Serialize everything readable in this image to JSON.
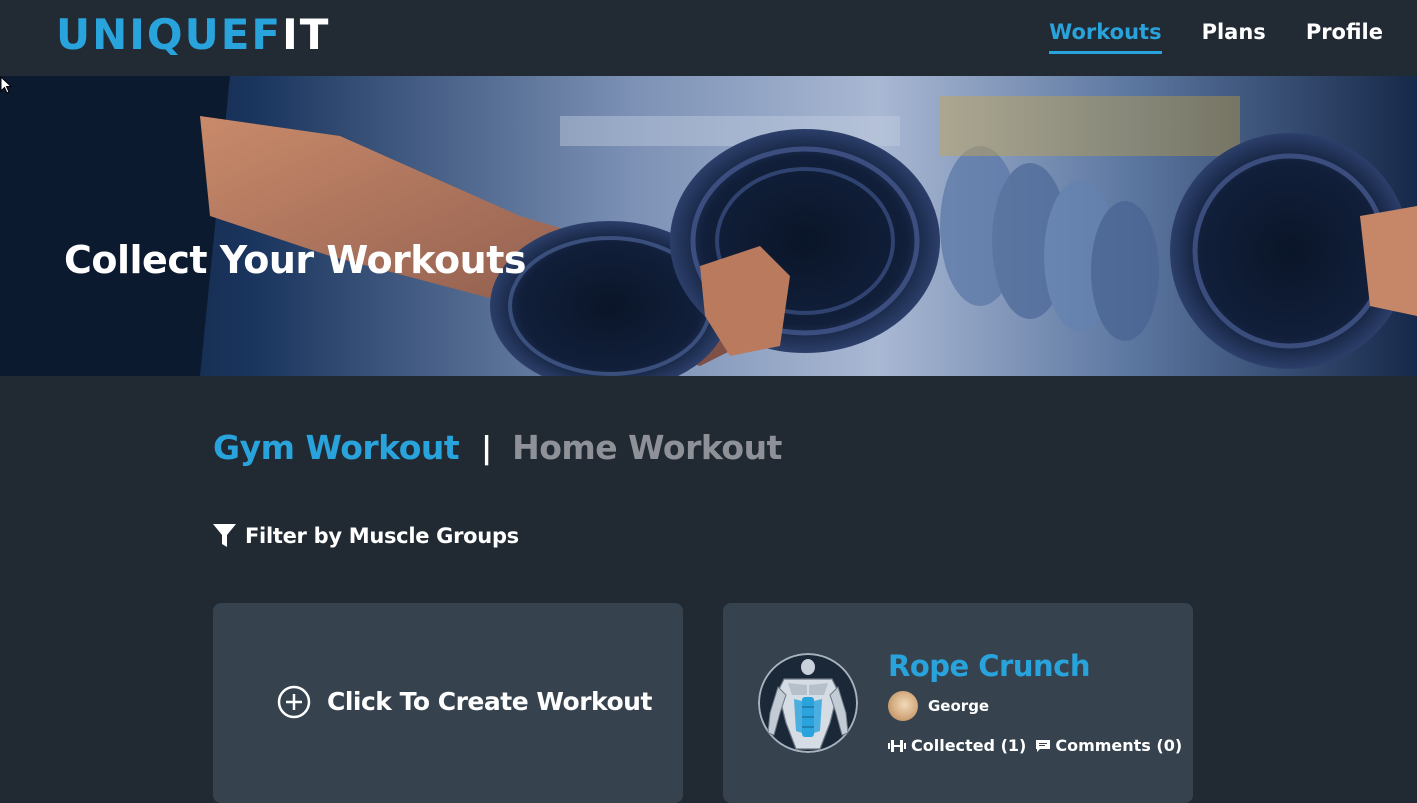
{
  "navbar": {
    "logo": {
      "part1": "UNIQUEF",
      "part2": "IT",
      "accent_color": "#29a3dc"
    },
    "links": [
      {
        "label": "Workouts",
        "active": true
      },
      {
        "label": "Plans",
        "active": false
      },
      {
        "label": "Profile",
        "active": false
      }
    ]
  },
  "hero": {
    "title": "Collect Your Workouts",
    "image_icon": "dumbbell-photo"
  },
  "tabs": {
    "gym": "Gym Workout",
    "separator": "|",
    "home": "Home Workout",
    "active": "gym"
  },
  "filter": {
    "label": "Filter by Muscle Groups",
    "icon": "filter-icon"
  },
  "create_card": {
    "label": "Click To Create Workout",
    "icon": "plus-circle-icon"
  },
  "workout_card": {
    "title": "Rope Crunch",
    "thumbnail_icon": "muscle-body-icon",
    "author": "George",
    "collected_label": "Collected (1)",
    "comments_label": "Comments (0)"
  },
  "colors": {
    "background": "#212a33",
    "card": "#36434f",
    "accent": "#29a3dc",
    "muted": "#8e9298"
  }
}
